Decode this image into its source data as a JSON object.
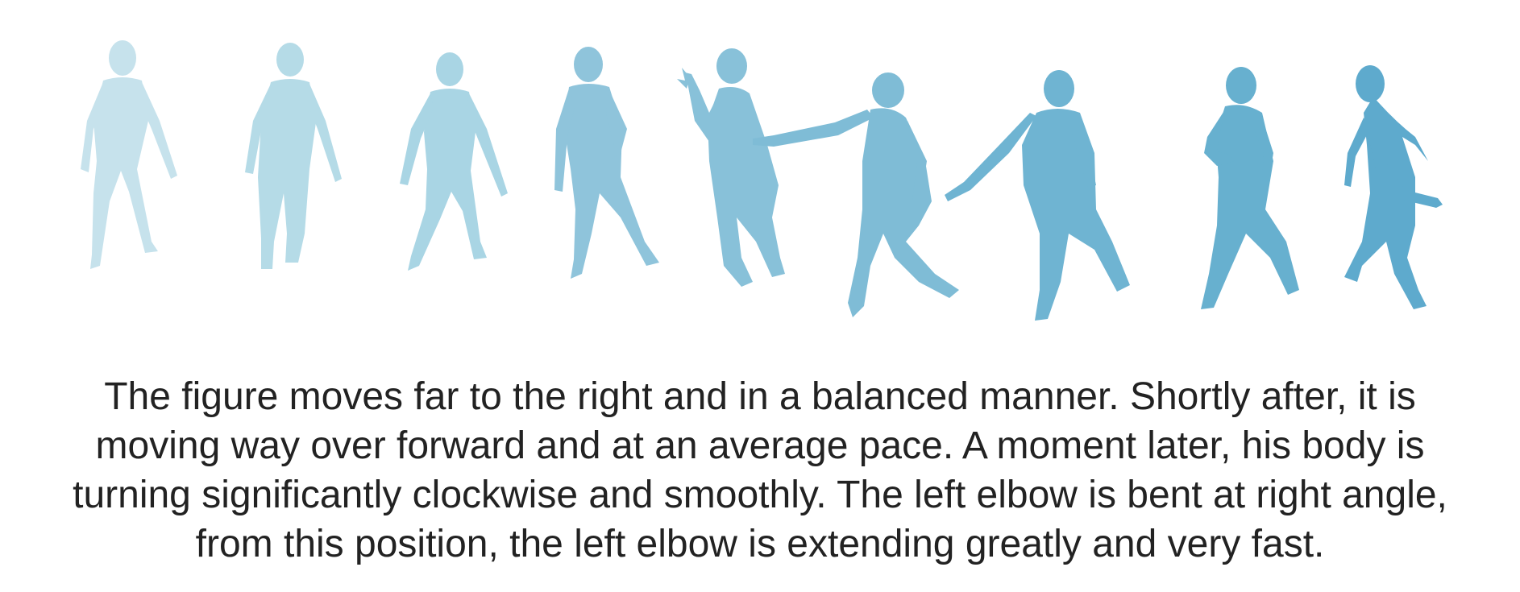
{
  "figure": {
    "frames": [
      {
        "pose": "standing-neutral",
        "color": "#c6e2ec"
      },
      {
        "pose": "standing-neutral",
        "color": "#b5dbe7"
      },
      {
        "pose": "standing-wide",
        "color": "#a9d5e4"
      },
      {
        "pose": "stepping",
        "color": "#8fc4db"
      },
      {
        "pose": "crouch-hand-raised",
        "color": "#88c1d9"
      },
      {
        "pose": "lunge-arm-extended",
        "color": "#7fbcd6"
      },
      {
        "pose": "torso-turn-arm-back",
        "color": "#6fb4d2"
      },
      {
        "pose": "striding",
        "color": "#67b0cf"
      },
      {
        "pose": "twist-kick",
        "color": "#5eaacd"
      }
    ]
  },
  "caption": {
    "lines": [
      "The figure moves far to the right and in a balanced manner. Shortly after, it is",
      "moving way over forward and at an average pace. A moment later, his body is",
      "turning significantly clockwise and smoothly. The left elbow is bent at right angle,",
      "from this position, the left elbow is extending greatly and very fast."
    ]
  }
}
